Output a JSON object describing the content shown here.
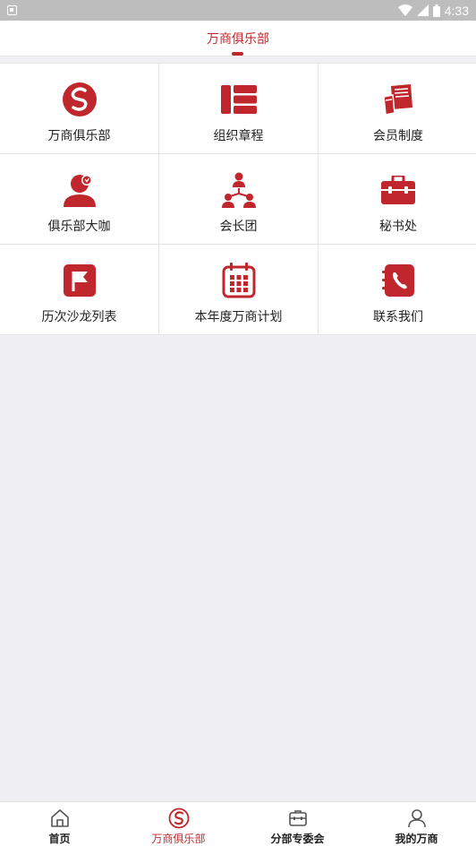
{
  "status_bar": {
    "time": "4:33"
  },
  "header": {
    "title": "万商俱乐部"
  },
  "grid": {
    "items": [
      {
        "label": "万商俱乐部",
        "icon": "club-logo-icon"
      },
      {
        "label": "组织章程",
        "icon": "list-icon"
      },
      {
        "label": "会员制度",
        "icon": "book-icon"
      },
      {
        "label": "俱乐部大咖",
        "icon": "vip-person-icon"
      },
      {
        "label": "会长团",
        "icon": "org-chart-icon"
      },
      {
        "label": "秘书处",
        "icon": "briefcase-icon"
      },
      {
        "label": "历次沙龙列表",
        "icon": "flag-icon"
      },
      {
        "label": "本年度万商计划",
        "icon": "calendar-icon"
      },
      {
        "label": "联系我们",
        "icon": "phone-book-icon"
      }
    ]
  },
  "bottom_nav": {
    "items": [
      {
        "label": "首页",
        "icon": "home-icon"
      },
      {
        "label": "万商俱乐部",
        "icon": "club-logo-icon"
      },
      {
        "label": "分部专委会",
        "icon": "briefcase-icon"
      },
      {
        "label": "我的万商",
        "icon": "user-icon"
      }
    ],
    "active_index": 1
  },
  "colors": {
    "accent": "#c0272d",
    "background": "#efeff4"
  }
}
